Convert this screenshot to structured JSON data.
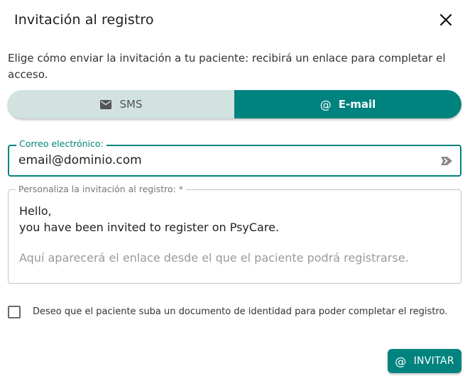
{
  "dialog": {
    "title": "Invitación al registro",
    "description": "Elige cómo enviar la invitación a tu paciente: recibirá un enlace para completar el acceso."
  },
  "toggle": {
    "sms_label": "SMS",
    "sms_icon": "mail-icon",
    "email_label": "E-mail",
    "email_icon": "at-icon",
    "selected": "E-mail"
  },
  "email_field": {
    "label": "Correo electrónico:",
    "value": "email@dominio.com"
  },
  "message_field": {
    "label": "Personaliza la invitación al registro: *",
    "line1": "Hello,",
    "line2": "you have been invited to register on PsyCare.",
    "placeholder": "Aquí aparecerá el enlace desde el que el paciente podrá registrarse."
  },
  "checkbox": {
    "label": "Deseo que el paciente suba un documento de identidad para poder completar el registro.",
    "checked": false
  },
  "invite_button": {
    "label": "INVITAR",
    "icon": "at-icon"
  },
  "colors": {
    "accent": "#00837f",
    "toggle_bg": "#d1e2e0"
  }
}
